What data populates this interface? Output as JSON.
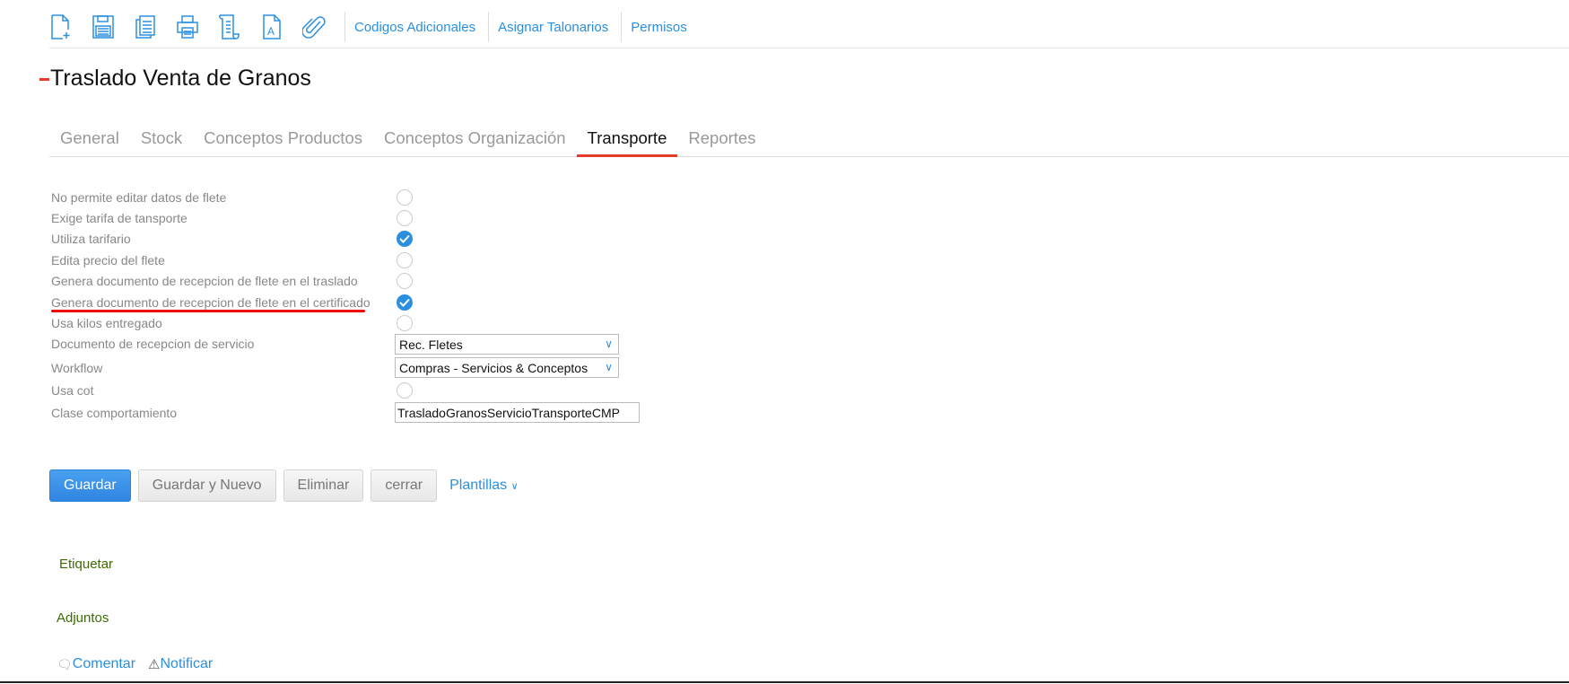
{
  "toolbar": {
    "icons": [
      "new-document-icon",
      "save-icon",
      "copy-icon",
      "print-icon",
      "scroll-icon",
      "text-document-icon",
      "attachment-icon"
    ],
    "links": [
      "Codigos Adicionales",
      "Asignar Talonarios",
      "Permisos"
    ]
  },
  "title": "Traslado Venta de Granos",
  "tabs": [
    "General",
    "Stock",
    "Conceptos Productos",
    "Conceptos Organización",
    "Transporte",
    "Reportes"
  ],
  "active_tab": "Transporte",
  "form": {
    "no_permite": "No permite editar datos de flete",
    "exige": "Exige tarifa de tansporte",
    "utiliza": "Utiliza tarifario",
    "edita": "Edita precio del flete",
    "genera_traslado": "Genera documento de recepcion de flete en el traslado",
    "genera_cert": "Genera documento de recepcion de flete en el certificado",
    "usa_kilos": "Usa kilos entregado",
    "doc_recep": "Documento de recepcion de servicio",
    "doc_recep_value": "Rec. Fletes",
    "workflow": "Workflow",
    "workflow_value": "Compras - Servicios & Conceptos",
    "usa_cot": "Usa cot",
    "clase": "Clase comportamiento",
    "clase_value": "TrasladoGranosServicioTransporteCMP"
  },
  "buttons": {
    "guardar": "Guardar",
    "guardar_nuevo": "Guardar y Nuevo",
    "eliminar": "Eliminar",
    "cerrar": "cerrar",
    "plantillas": "Plantillas"
  },
  "etiquetar": "Etiquetar",
  "adjuntos": "Adjuntos",
  "comentar": "Comentar",
  "notificar": "Notificar",
  "colors": {
    "accent": "#2b8fe0",
    "marker": "#e53b2c"
  }
}
